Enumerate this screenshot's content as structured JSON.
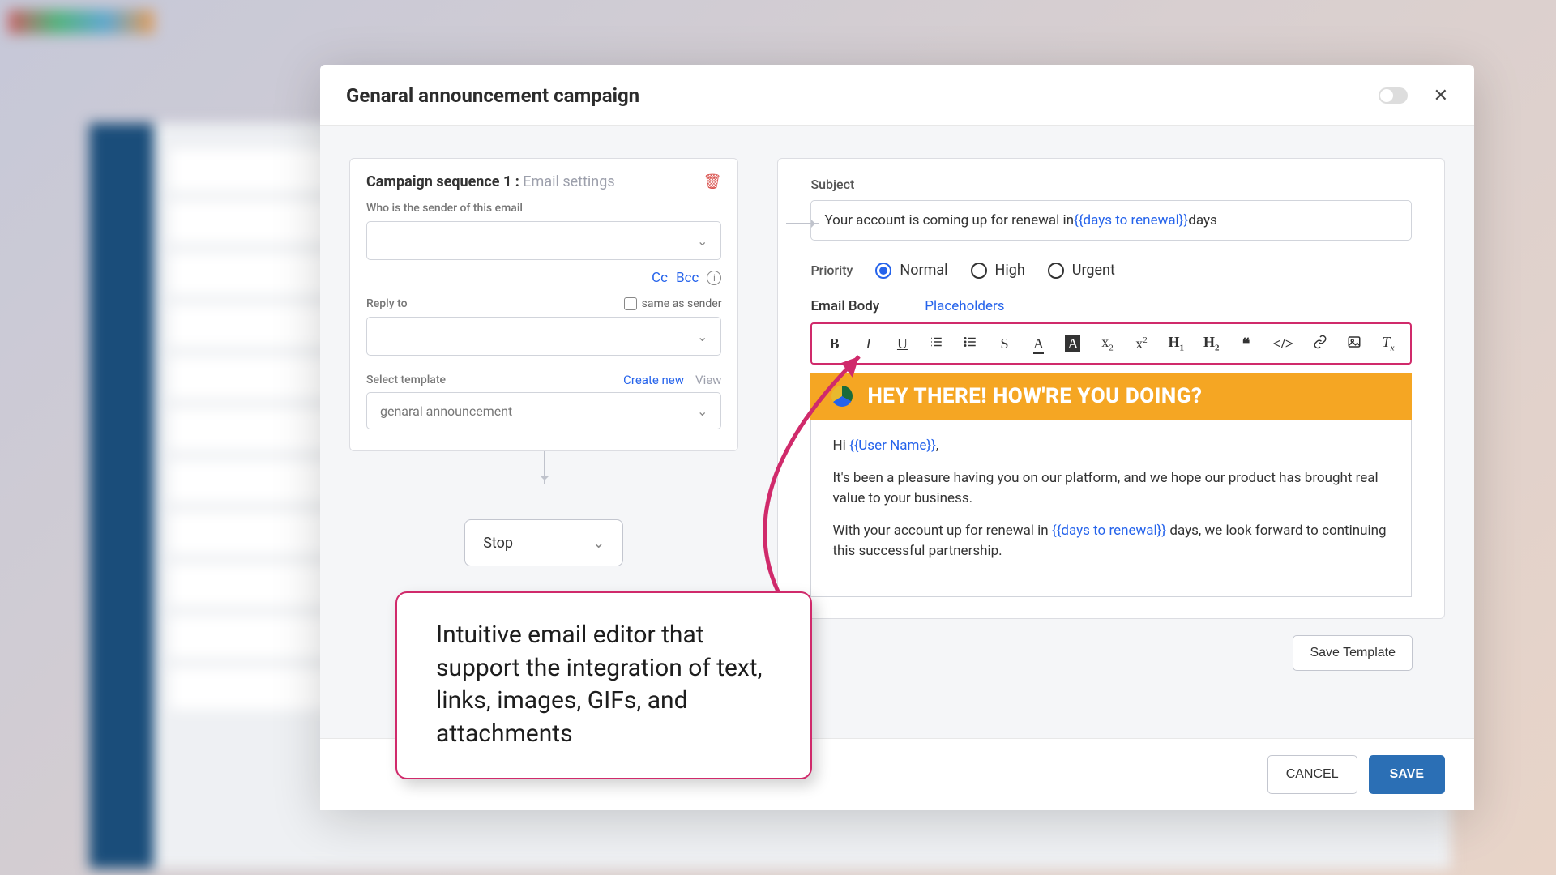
{
  "modal": {
    "title": "Genaral announcement campaign"
  },
  "sequence": {
    "title_bold": "Campaign sequence 1 :",
    "title_sub": "Email settings",
    "sender_label": "Who is the sender of this email",
    "cc": "Cc",
    "bcc": "Bcc",
    "reply_to_label": "Reply to",
    "same_as_sender": "same as sender",
    "select_template_label": "Select template",
    "create_new": "Create new",
    "view": "View",
    "template_value": "genaral announcement",
    "stop": "Stop"
  },
  "email": {
    "subject_label": "Subject",
    "subject_pre": "Your account is coming up for renewal in ",
    "subject_ph": "{{days to renewal}}",
    "subject_post": " days",
    "priority_label": "Priority",
    "priority_options": {
      "normal": "Normal",
      "high": "High",
      "urgent": "Urgent"
    },
    "tab_body": "Email Body",
    "tab_placeholders": "Placeholders",
    "banner": "HEY THERE! HOW'RE YOU DOING?",
    "body_hi": "Hi ",
    "body_user_ph": "{{User Name}}",
    "body_hi_post": ",",
    "body_p1": "It's been a pleasure having you on our platform, and we hope our product has brought real value to your business.",
    "body_p2_pre": "With your account up for renewal in ",
    "body_p2_ph": "{{days to renewal}}",
    "body_p2_post": " days, we look forward to continuing this successful partnership.",
    "save_template": "Save Template"
  },
  "footer": {
    "cancel": "CANCEL",
    "save": "SAVE"
  },
  "callout": "Intuitive email editor that support the integration of text, links, images, GIFs, and attachments",
  "colors": {
    "accent": "#d02a6b",
    "link": "#2563eb",
    "primary": "#2b6fb5",
    "banner": "#f5a623"
  }
}
